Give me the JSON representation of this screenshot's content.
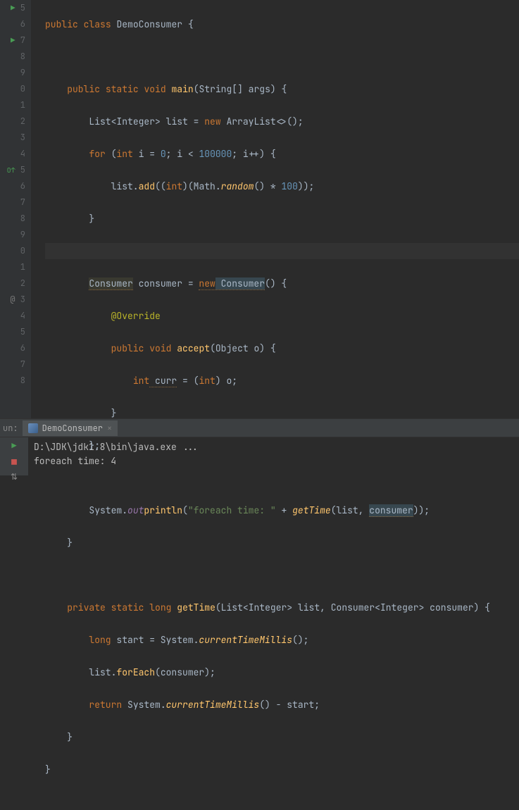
{
  "line_numbers": [
    "5",
    "6",
    "7",
    "8",
    "9",
    "0",
    "1",
    "2",
    "3",
    "4",
    "5",
    "6",
    "7",
    "8",
    "9",
    "0",
    "1",
    "2",
    "3",
    "4",
    "5",
    "6",
    "7",
    "8"
  ],
  "code": {
    "class_decl": {
      "kw1": "public",
      "kw2": "class",
      "name": "DemoConsumer",
      "brace": "{"
    },
    "main_decl": {
      "kw1": "public",
      "kw2": "static",
      "kw3": "void",
      "method": "main",
      "args": "(String[] args)",
      "brace": "{"
    },
    "list_decl": {
      "type": "List",
      "gen_l": "<",
      "gen": "Integer",
      "gen_r": ">",
      "var": " list = ",
      "kw": "new",
      "ctor": " ArrayList<>();"
    },
    "for_decl": {
      "kw": "for",
      "open": " (",
      "kw2": "int",
      "init": " i = ",
      "zero": "0",
      "sep1": "; i < ",
      "limit": "100000",
      "sep2": "; i++) {"
    },
    "add": {
      "obj": "list.",
      "method": "add",
      "args1": "((",
      "kw": "int",
      "args2": ")(Math.",
      "method2": "random",
      "args3": "() * ",
      "num": "100",
      "close": "));"
    },
    "brace_close": "}",
    "consumer_decl": {
      "type": "Consumer",
      "var": " consumer = ",
      "kw": "new",
      "type2": " Consumer",
      "args": "() {"
    },
    "override": "@Override",
    "accept": {
      "kw1": "public",
      "kw2": "void",
      "method": "accept",
      "args": "(Object o) {"
    },
    "curr": {
      "kw": "int",
      "var": " curr",
      " eq": " = (",
      "kw2": "int",
      "rest": ") o;"
    },
    "close2": "};",
    "println": {
      "sys": "System.",
      "out": "out",
      ".p": ".",
      "method": "println",
      "open": "(",
      "str": "\"foreach time: \"",
      "plus": " + ",
      "gt": "getTime",
      "args2": "(list, ",
      "cons": "consumer",
      "close": "));"
    },
    "gettime_decl": {
      "kw1": "private",
      "kw2": "static",
      "kw3": "long",
      "method": "getTime",
      "open": "(List",
      "gen_l": "<",
      "gen": "Integer",
      "gen_r": ">",
      "p1": " list, Consumer",
      "gen2_l": "<",
      "gen2": "Integer",
      "gen2_r": ">",
      "p2": " consumer) {"
    },
    "start": {
      "kw": "long",
      "var": " start = System.",
      "method": "currentTimeMillis",
      "close": "();"
    },
    "foreach": {
      "obj": "list.",
      "method": "forEach",
      "args": "(consumer);"
    },
    "ret": {
      "kw": "return",
      "sys": " System.",
      "method": "currentTimeMillis",
      "rest": "() - start;"
    }
  },
  "run_panel": {
    "label": "un:",
    "tab_name": "DemoConsumer",
    "out_line1": "D:\\JDK\\jdk1.8\\bin\\java.exe ...",
    "out_line2": "foreach time: 4"
  }
}
